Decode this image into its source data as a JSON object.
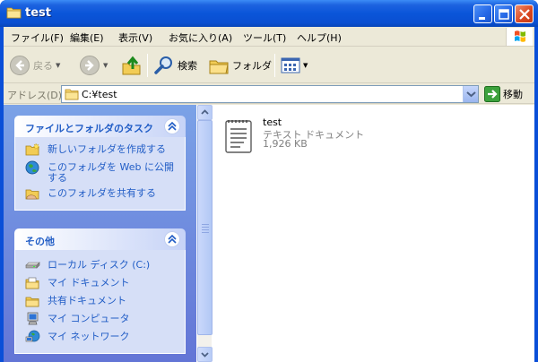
{
  "window": {
    "title": "test"
  },
  "menu": [
    "ファイル(F)",
    "編集(E)",
    "表示(V)",
    "お気に入り(A)",
    "ツール(T)",
    "ヘルプ(H)"
  ],
  "toolbar": {
    "back": "戻る",
    "search": "検索",
    "folders": "フォルダ"
  },
  "address": {
    "label": "アドレス(D)",
    "value": "C:¥test",
    "go": "移動"
  },
  "tasks_panel": {
    "title": "ファイルとフォルダのタスク",
    "items": [
      "新しいフォルダを作成する",
      "このフォルダを Web に公開する",
      "このフォルダを共有する"
    ]
  },
  "other_panel": {
    "title": "その他",
    "items": [
      "ローカル ディスク (C:)",
      "マイ ドキュメント",
      "共有ドキュメント",
      "マイ コンピュータ",
      "マイ ネットワーク"
    ]
  },
  "file": {
    "name": "test",
    "type": "テキスト ドキュメント",
    "size": "1,926 KB"
  },
  "colors": {
    "titlebar": "#0a55d9",
    "taskpane": "#6f8de0",
    "panel_title": "#215dc6",
    "link": "#215dc6"
  },
  "icons": [
    "folder-icon",
    "minimize-icon",
    "maximize-icon",
    "close-icon",
    "windows-logo-icon",
    "back-arrow-icon",
    "forward-arrow-icon",
    "up-folder-icon",
    "search-icon",
    "folders-icon",
    "views-icon",
    "go-arrow-icon",
    "new-folder-icon",
    "web-publish-icon",
    "share-folder-icon",
    "local-disk-icon",
    "my-documents-icon",
    "shared-documents-icon",
    "my-computer-icon",
    "my-network-icon",
    "text-document-icon"
  ]
}
